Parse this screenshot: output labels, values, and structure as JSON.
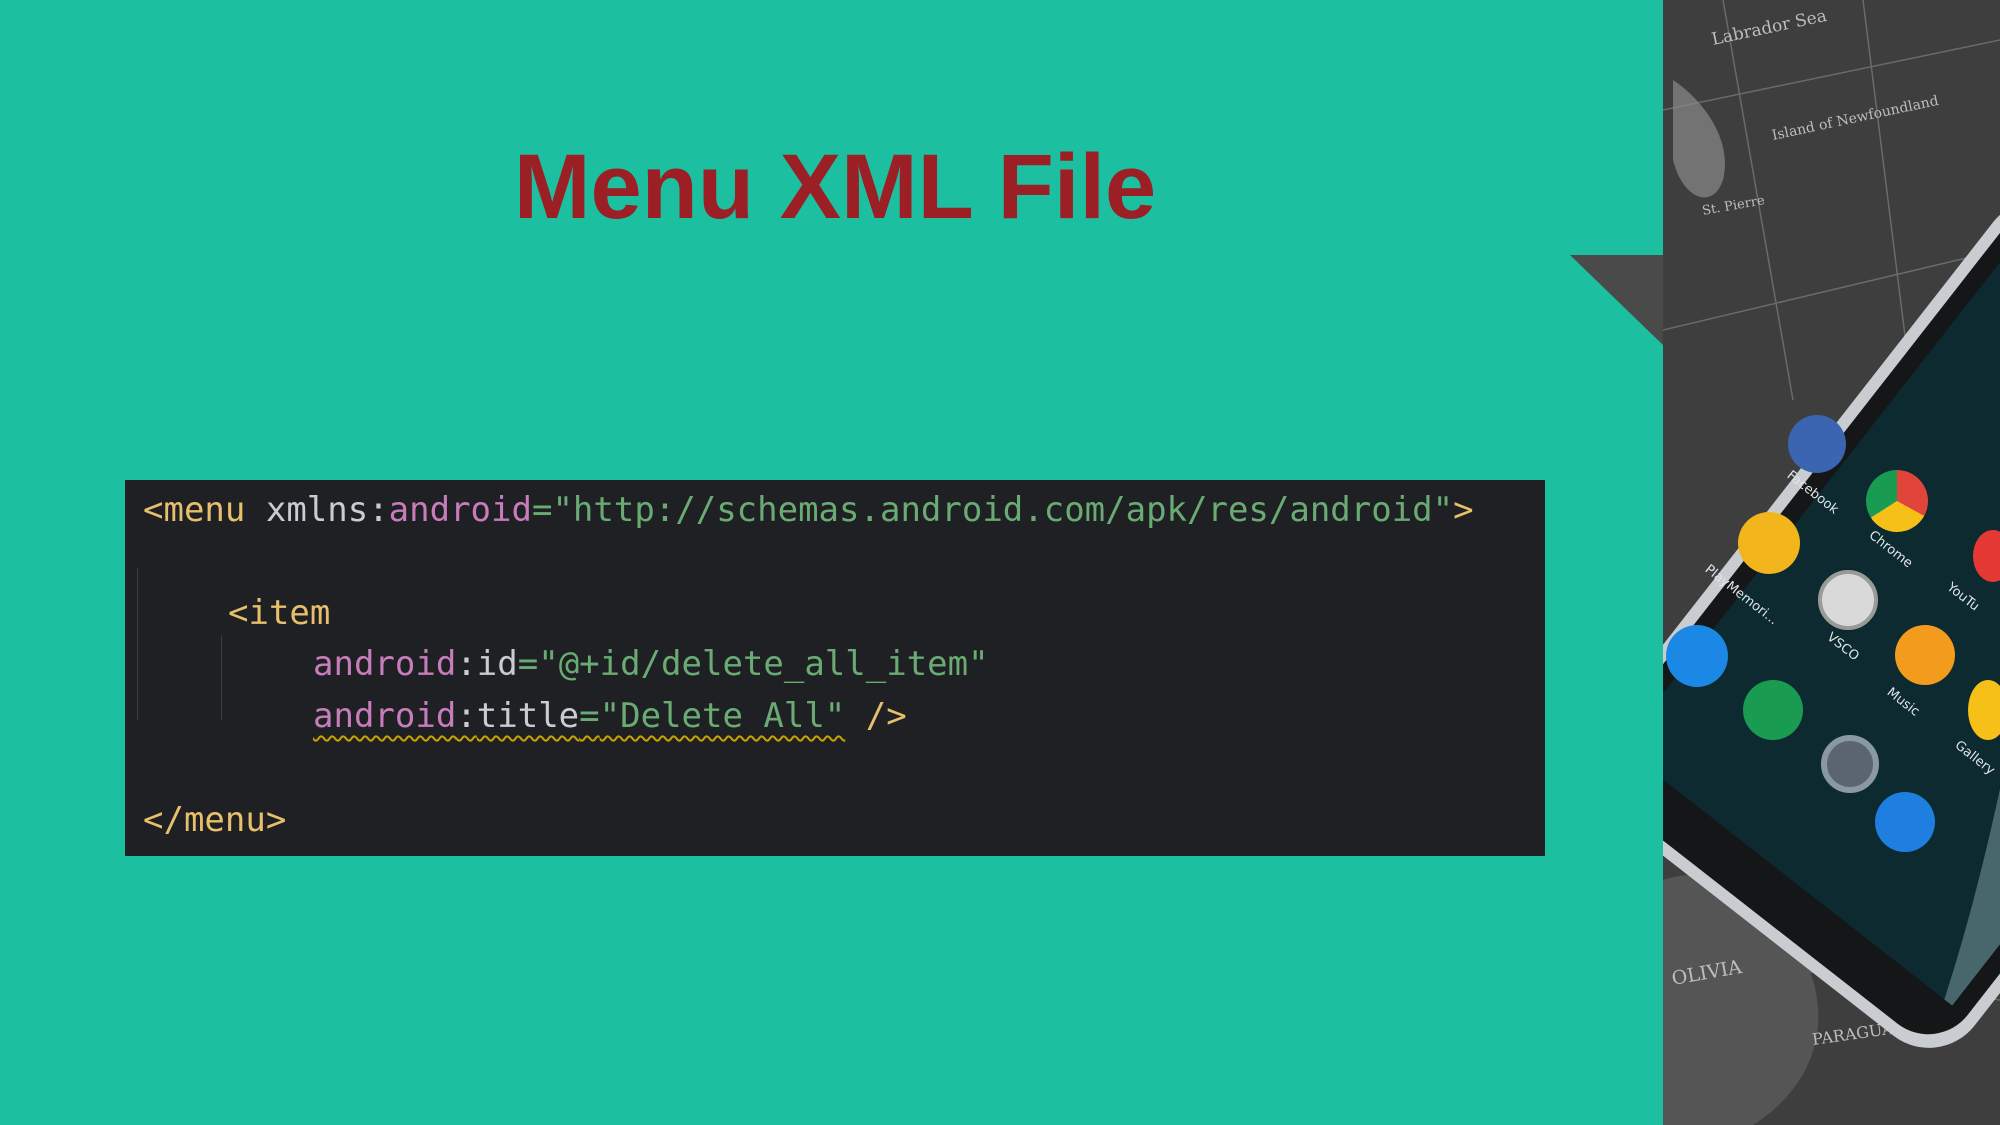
{
  "slide": {
    "title": "Menu XML File",
    "colors": {
      "background": "#1cbf9f",
      "title": "#9b1f24",
      "code_background": "#1f2024"
    }
  },
  "code": {
    "line1": {
      "open_tag": "<menu",
      "attr_prefix": "xmlns:",
      "attr_name": "android",
      "equals": "=",
      "value": "\"http://schemas.android.com/apk/res/android\"",
      "close": ">"
    },
    "line2": {
      "open_tag": "<item"
    },
    "line3": {
      "ns": "android",
      "colon": ":",
      "attr": "id",
      "equals": "=",
      "value": "\"@+id/delete_all_item\""
    },
    "line4": {
      "ns": "android",
      "colon": ":",
      "attr": "title",
      "equals": "=",
      "value": "\"Delete All\"",
      "close": " />"
    },
    "line5": {
      "close_tag": "</menu>"
    }
  },
  "decor": {
    "map_labels": [
      "Labrador Sea",
      "Island of Newfoundland",
      "St. Pierre",
      "OLIVIA",
      "PARAGUAY"
    ],
    "apps": [
      {
        "name": "Facebook",
        "icon": "facebook-icon",
        "color": "#3b65b0"
      },
      {
        "name": "Chrome",
        "icon": "chrome-icon",
        "color": "#e0443a"
      },
      {
        "name": "PlayMemori...",
        "icon": "playmemories-icon",
        "color": "#f3b51c"
      },
      {
        "name": "VSCO",
        "icon": "vsco-icon",
        "color": "#d9d9d9"
      },
      {
        "name": "Music",
        "icon": "music-icon",
        "color": "#f29b1d"
      },
      {
        "name": "YouTu",
        "icon": "youtube-icon",
        "color": "#e53935"
      },
      {
        "name": "Gallery",
        "icon": "gallery-icon",
        "color": "#f6c018"
      },
      {
        "name": "",
        "icon": "messenger-icon",
        "color": "#1c88e5"
      },
      {
        "name": "",
        "icon": "hangouts-icon",
        "color": "#199c52"
      },
      {
        "name": "",
        "icon": "camera-icon",
        "color": "#5a6570"
      },
      {
        "name": "",
        "icon": "phone-icon",
        "color": "#1e7fe0"
      }
    ]
  }
}
